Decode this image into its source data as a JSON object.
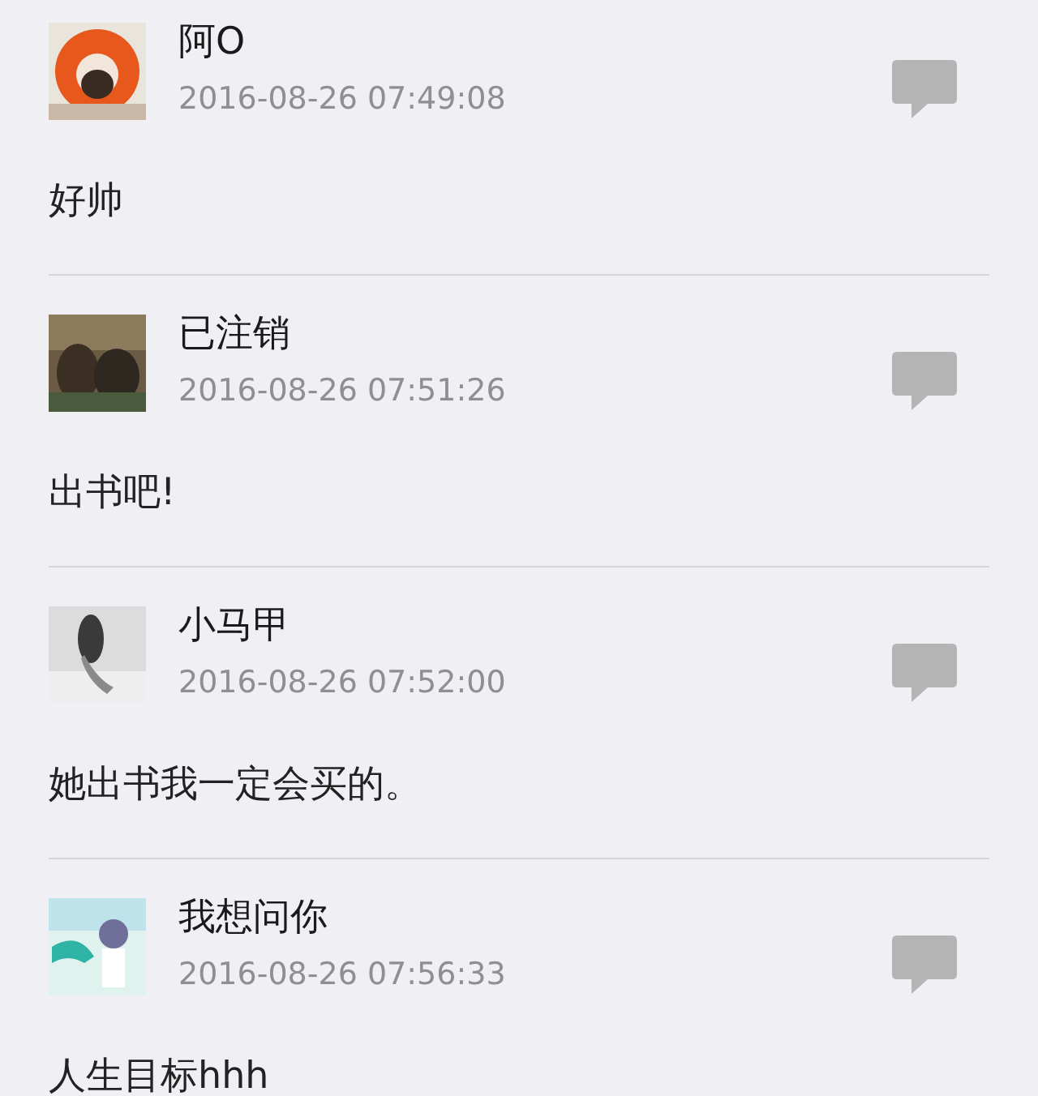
{
  "comments": [
    {
      "user": "阿O",
      "time": "2016-08-26 07:49:08",
      "text": "好帅"
    },
    {
      "user": "已注销",
      "time": "2016-08-26 07:51:26",
      "text": "出书吧!"
    },
    {
      "user": "小马甲",
      "time": "2016-08-26 07:52:00",
      "text": "她出书我一定会买的。"
    },
    {
      "user": "我想问你",
      "time": "2016-08-26 07:56:33",
      "text": "人生目标hhh"
    }
  ]
}
